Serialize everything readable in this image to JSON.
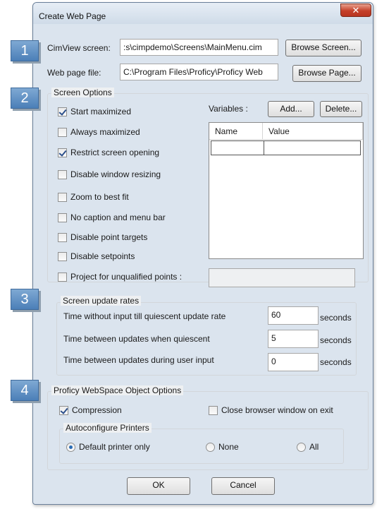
{
  "window": {
    "title": "Create Web Page",
    "close_symbol": "✕"
  },
  "badges": [
    "1",
    "2",
    "3",
    "4"
  ],
  "top": {
    "cimview_label": "CimView screen:",
    "cimview_value": ":s\\cimpdemo\\Screens\\MainMenu.cim",
    "browse_screen_label": "Browse Screen...",
    "webpage_label": "Web page file:",
    "webpage_value": "C:\\Program Files\\Proficy\\Proficy Web",
    "browse_page_label": "Browse Page..."
  },
  "screen_options": {
    "title": "Screen Options",
    "checkboxes": [
      {
        "label": "Start maximized",
        "checked": true
      },
      {
        "label": "Always maximized",
        "checked": false
      },
      {
        "label": "Restrict screen opening",
        "checked": true
      },
      {
        "label": "Disable window resizing",
        "checked": false
      },
      {
        "label": "Zoom to best fit",
        "checked": false
      },
      {
        "label": "No caption and menu bar",
        "checked": false
      },
      {
        "label": "Disable point targets",
        "checked": false
      },
      {
        "label": "Disable setpoints",
        "checked": false
      }
    ],
    "variables_label": "Variables :",
    "add_label": "Add...",
    "delete_label": "Delete...",
    "columns": [
      "Name",
      "Value"
    ],
    "project_label": "Project for unqualified points :",
    "project_checked": false,
    "project_value": ""
  },
  "update_rates": {
    "title": "Screen update rates",
    "rows": [
      {
        "label": "Time without input till quiescent update rate",
        "value": "60",
        "unit": "seconds"
      },
      {
        "label": "Time between updates when quiescent",
        "value": "5",
        "unit": "seconds"
      },
      {
        "label": "Time between updates during user input",
        "value": "0",
        "unit": "seconds"
      }
    ]
  },
  "webspace": {
    "title": "Proficy WebSpace Object Options",
    "compression_label": "Compression",
    "compression_checked": true,
    "close_browser_label": "Close browser window on exit",
    "close_browser_checked": false,
    "printers_title": "Autoconfigure Printers",
    "printer_options": [
      {
        "label": "Default printer only",
        "selected": true
      },
      {
        "label": "None",
        "selected": false
      },
      {
        "label": "All",
        "selected": false
      }
    ]
  },
  "buttons": {
    "ok": "OK",
    "cancel": "Cancel"
  }
}
